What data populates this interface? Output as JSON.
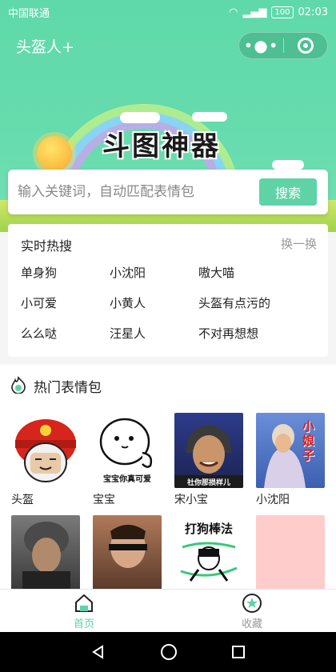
{
  "status_bar": {
    "carrier": "中国联通",
    "battery": "100",
    "time": "02:03"
  },
  "nav": {
    "title": "头盔人+",
    "more_icon": "dots-icon",
    "close_icon": "target-icon"
  },
  "hero": {
    "title": "斗图神器"
  },
  "search": {
    "placeholder": "输入关键词，自动匹配表情包",
    "value": "",
    "button_label": "搜索"
  },
  "hot": {
    "title": "实时热搜",
    "refresh_label": "换一换",
    "items": [
      "单身狗",
      "小沈阳",
      "嗷大喵",
      "小可爱",
      "小黄人",
      "头盔有点污的",
      "么么哒",
      "汪星人",
      "不对再想想"
    ]
  },
  "popular": {
    "title": "热门表情包",
    "memes": [
      {
        "label": "头盔",
        "caption": ""
      },
      {
        "label": "宝宝",
        "caption": "宝宝你真可爱"
      },
      {
        "label": "宋小宝",
        "caption": "社你那损样儿"
      },
      {
        "label": "小沈阳",
        "caption": "小娘子"
      },
      {
        "label": "",
        "caption": ""
      },
      {
        "label": "",
        "caption": ""
      },
      {
        "label": "",
        "caption": "打狗棒法"
      },
      {
        "label": "",
        "caption": ""
      }
    ]
  },
  "tabbar": {
    "tabs": [
      {
        "label": "首页",
        "icon": "home-icon",
        "active": true
      },
      {
        "label": "收藏",
        "icon": "star-icon",
        "active": false
      }
    ]
  },
  "colors": {
    "accent": "#5fd3a6",
    "inactive": "#999999"
  }
}
